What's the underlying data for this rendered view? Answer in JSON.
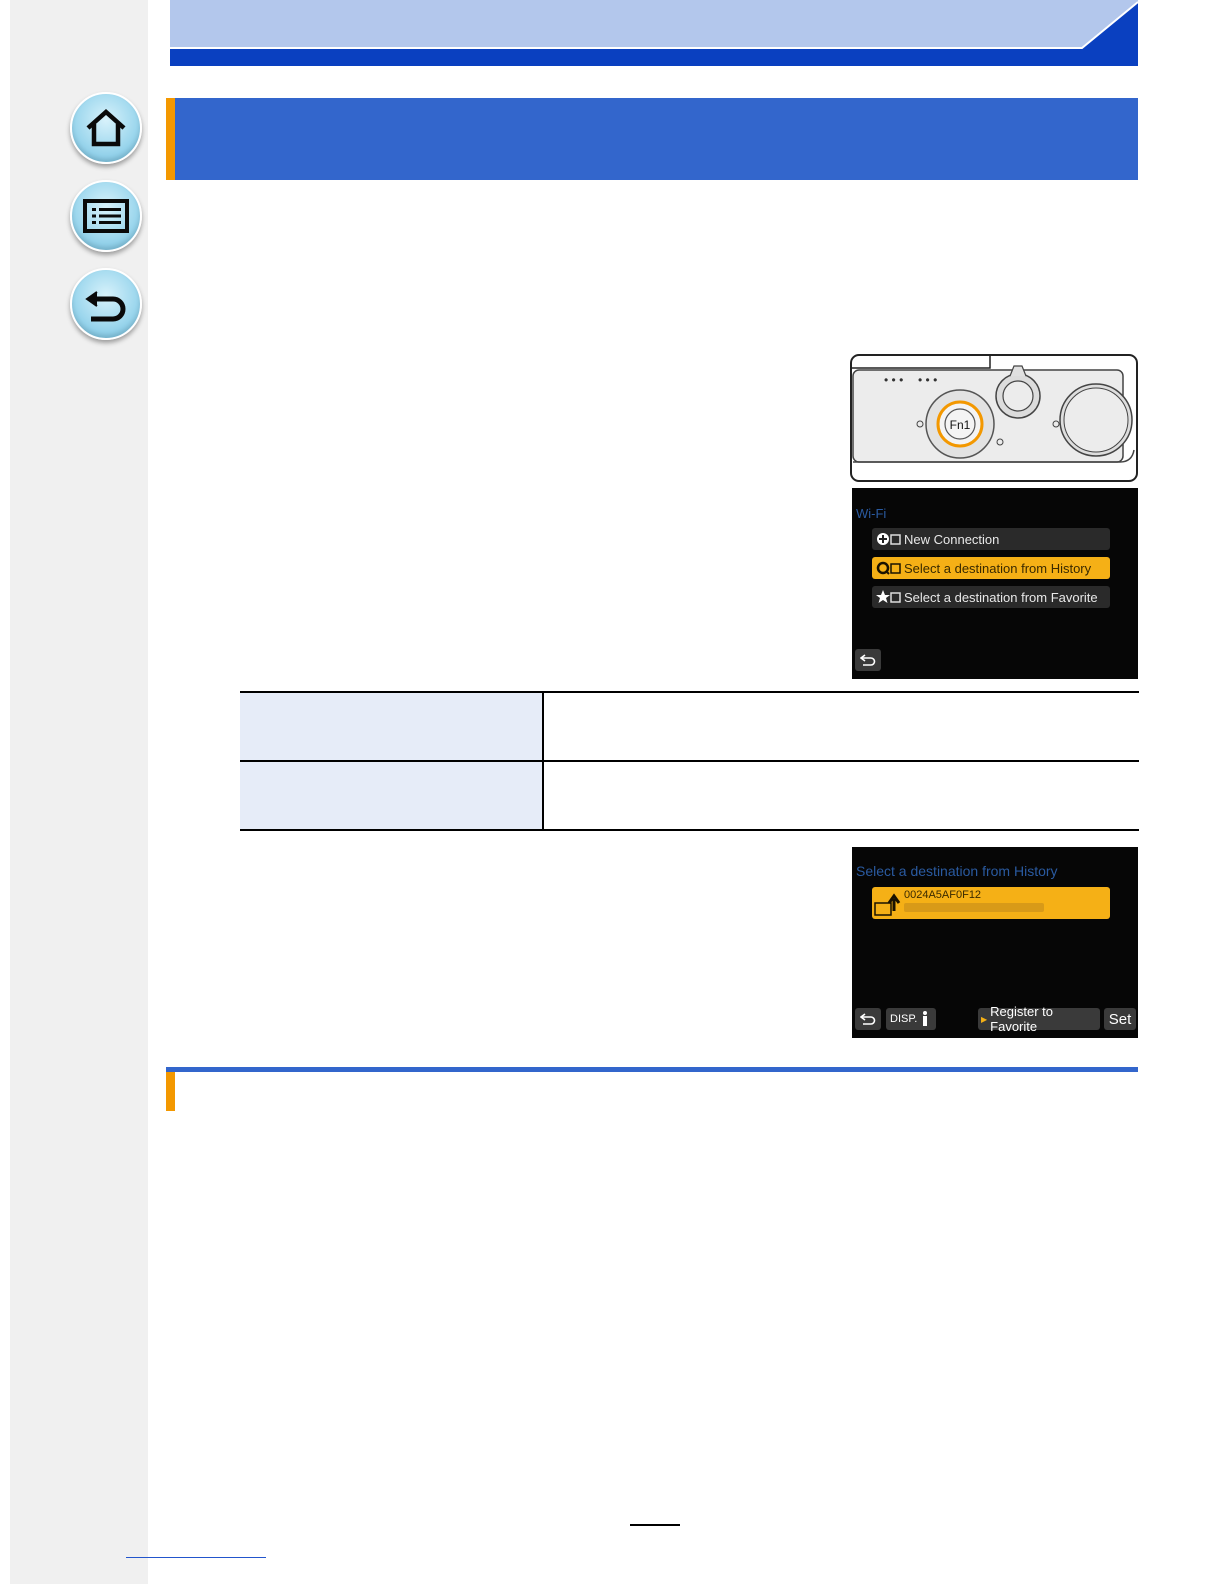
{
  "header": {
    "section_title": ""
  },
  "nav": {
    "home": {
      "icon": "home-icon"
    },
    "contents": {
      "icon": "list-icon"
    },
    "back": {
      "icon": "return-arrow-icon"
    }
  },
  "camera": {
    "button_label": "Fn1"
  },
  "wifi_menu": {
    "title": "Wi-Fi",
    "items": [
      {
        "label": "New Connection",
        "icon": "plus-icon",
        "selected": false
      },
      {
        "label": "Select a destination from History",
        "icon": "history-icon",
        "selected": true
      },
      {
        "label": "Select a destination from Favorite",
        "icon": "star-icon",
        "selected": false
      }
    ],
    "back_icon": "return-arrow-icon"
  },
  "options_table": {
    "rows": [
      {
        "label": "",
        "description": ""
      },
      {
        "label": "",
        "description": ""
      }
    ]
  },
  "history_screen": {
    "title": "Select a destination from History",
    "entry": {
      "name": "0024A5AF0F12",
      "detail": ""
    },
    "footer": {
      "disp": "DISP.",
      "register": "Register to Favorite",
      "set": "Set"
    }
  },
  "colors": {
    "header_blue": "#3366cc",
    "accent_orange": "#f39800",
    "selected_yellow": "#f5b016",
    "banner_light_blue": "#b3c7ec",
    "banner_dark_blue": "#0a40c0"
  }
}
